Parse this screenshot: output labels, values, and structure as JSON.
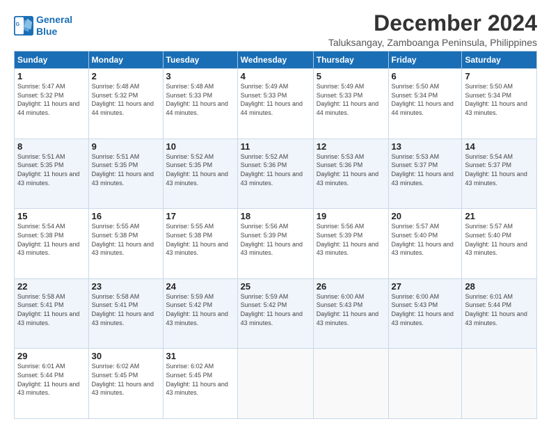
{
  "logo": {
    "line1": "General",
    "line2": "Blue"
  },
  "title": "December 2024",
  "location": "Taluksangay, Zamboanga Peninsula, Philippines",
  "days_of_week": [
    "Sunday",
    "Monday",
    "Tuesday",
    "Wednesday",
    "Thursday",
    "Friday",
    "Saturday"
  ],
  "weeks": [
    [
      {
        "day": "1",
        "sunrise": "5:47 AM",
        "sunset": "5:32 PM",
        "daylight": "11 hours and 44 minutes."
      },
      {
        "day": "2",
        "sunrise": "5:48 AM",
        "sunset": "5:32 PM",
        "daylight": "11 hours and 44 minutes."
      },
      {
        "day": "3",
        "sunrise": "5:48 AM",
        "sunset": "5:33 PM",
        "daylight": "11 hours and 44 minutes."
      },
      {
        "day": "4",
        "sunrise": "5:49 AM",
        "sunset": "5:33 PM",
        "daylight": "11 hours and 44 minutes."
      },
      {
        "day": "5",
        "sunrise": "5:49 AM",
        "sunset": "5:33 PM",
        "daylight": "11 hours and 44 minutes."
      },
      {
        "day": "6",
        "sunrise": "5:50 AM",
        "sunset": "5:34 PM",
        "daylight": "11 hours and 44 minutes."
      },
      {
        "day": "7",
        "sunrise": "5:50 AM",
        "sunset": "5:34 PM",
        "daylight": "11 hours and 43 minutes."
      }
    ],
    [
      {
        "day": "8",
        "sunrise": "5:51 AM",
        "sunset": "5:35 PM",
        "daylight": "11 hours and 43 minutes."
      },
      {
        "day": "9",
        "sunrise": "5:51 AM",
        "sunset": "5:35 PM",
        "daylight": "11 hours and 43 minutes."
      },
      {
        "day": "10",
        "sunrise": "5:52 AM",
        "sunset": "5:35 PM",
        "daylight": "11 hours and 43 minutes."
      },
      {
        "day": "11",
        "sunrise": "5:52 AM",
        "sunset": "5:36 PM",
        "daylight": "11 hours and 43 minutes."
      },
      {
        "day": "12",
        "sunrise": "5:53 AM",
        "sunset": "5:36 PM",
        "daylight": "11 hours and 43 minutes."
      },
      {
        "day": "13",
        "sunrise": "5:53 AM",
        "sunset": "5:37 PM",
        "daylight": "11 hours and 43 minutes."
      },
      {
        "day": "14",
        "sunrise": "5:54 AM",
        "sunset": "5:37 PM",
        "daylight": "11 hours and 43 minutes."
      }
    ],
    [
      {
        "day": "15",
        "sunrise": "5:54 AM",
        "sunset": "5:38 PM",
        "daylight": "11 hours and 43 minutes."
      },
      {
        "day": "16",
        "sunrise": "5:55 AM",
        "sunset": "5:38 PM",
        "daylight": "11 hours and 43 minutes."
      },
      {
        "day": "17",
        "sunrise": "5:55 AM",
        "sunset": "5:38 PM",
        "daylight": "11 hours and 43 minutes."
      },
      {
        "day": "18",
        "sunrise": "5:56 AM",
        "sunset": "5:39 PM",
        "daylight": "11 hours and 43 minutes."
      },
      {
        "day": "19",
        "sunrise": "5:56 AM",
        "sunset": "5:39 PM",
        "daylight": "11 hours and 43 minutes."
      },
      {
        "day": "20",
        "sunrise": "5:57 AM",
        "sunset": "5:40 PM",
        "daylight": "11 hours and 43 minutes."
      },
      {
        "day": "21",
        "sunrise": "5:57 AM",
        "sunset": "5:40 PM",
        "daylight": "11 hours and 43 minutes."
      }
    ],
    [
      {
        "day": "22",
        "sunrise": "5:58 AM",
        "sunset": "5:41 PM",
        "daylight": "11 hours and 43 minutes."
      },
      {
        "day": "23",
        "sunrise": "5:58 AM",
        "sunset": "5:41 PM",
        "daylight": "11 hours and 43 minutes."
      },
      {
        "day": "24",
        "sunrise": "5:59 AM",
        "sunset": "5:42 PM",
        "daylight": "11 hours and 43 minutes."
      },
      {
        "day": "25",
        "sunrise": "5:59 AM",
        "sunset": "5:42 PM",
        "daylight": "11 hours and 43 minutes."
      },
      {
        "day": "26",
        "sunrise": "6:00 AM",
        "sunset": "5:43 PM",
        "daylight": "11 hours and 43 minutes."
      },
      {
        "day": "27",
        "sunrise": "6:00 AM",
        "sunset": "5:43 PM",
        "daylight": "11 hours and 43 minutes."
      },
      {
        "day": "28",
        "sunrise": "6:01 AM",
        "sunset": "5:44 PM",
        "daylight": "11 hours and 43 minutes."
      }
    ],
    [
      {
        "day": "29",
        "sunrise": "6:01 AM",
        "sunset": "5:44 PM",
        "daylight": "11 hours and 43 minutes."
      },
      {
        "day": "30",
        "sunrise": "6:02 AM",
        "sunset": "5:45 PM",
        "daylight": "11 hours and 43 minutes."
      },
      {
        "day": "31",
        "sunrise": "6:02 AM",
        "sunset": "5:45 PM",
        "daylight": "11 hours and 43 minutes."
      },
      null,
      null,
      null,
      null
    ]
  ],
  "labels": {
    "sunrise": "Sunrise:",
    "sunset": "Sunset:",
    "daylight": "Daylight:"
  }
}
